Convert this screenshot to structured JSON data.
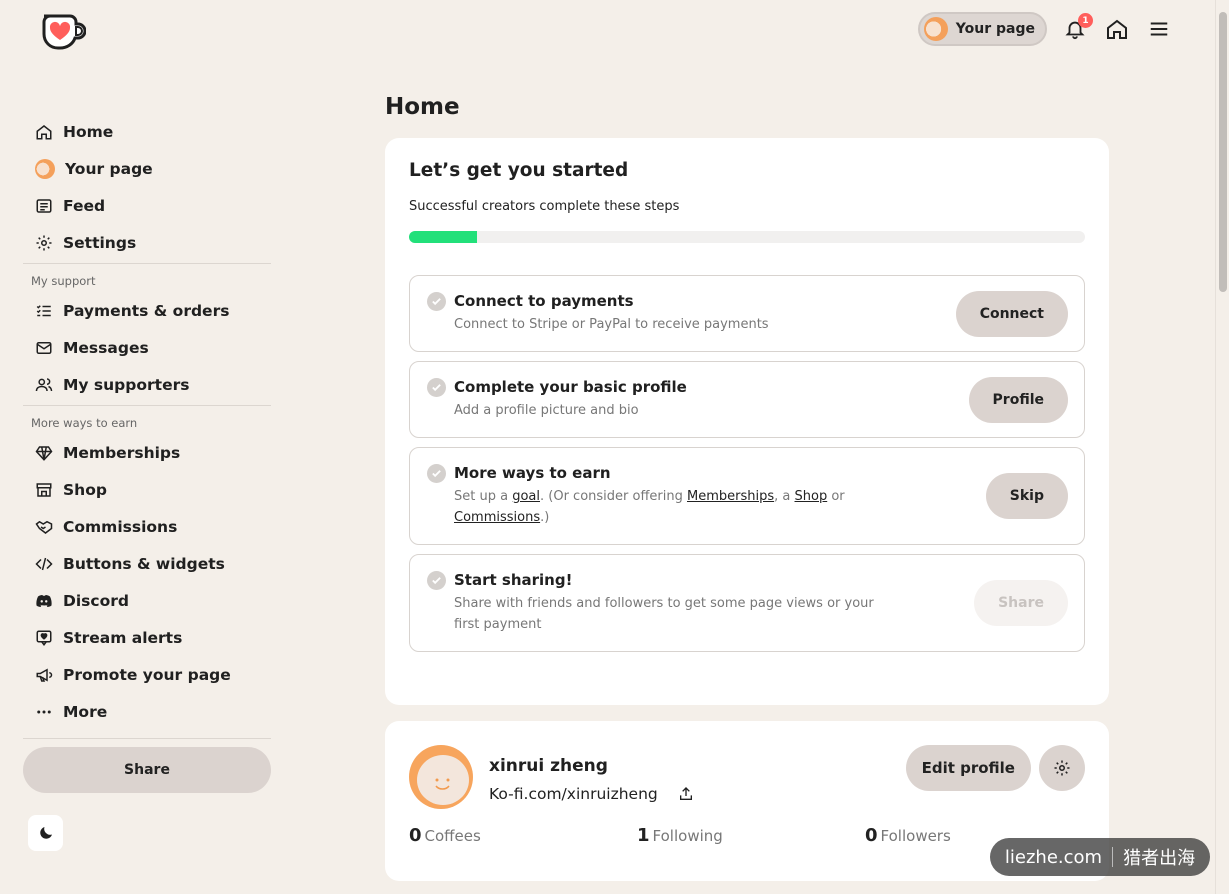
{
  "header": {
    "your_page_label": "Your page",
    "notification_count": "1"
  },
  "sidebar": {
    "items": [
      {
        "label": "Home",
        "icon": "home-icon"
      },
      {
        "label": "Your page",
        "icon": "avatar"
      },
      {
        "label": "Feed",
        "icon": "newspaper-icon"
      },
      {
        "label": "Settings",
        "icon": "gear-icon"
      }
    ],
    "support_label": "My support",
    "support_items": [
      {
        "label": "Payments & orders",
        "icon": "list-icon"
      },
      {
        "label": "Messages",
        "icon": "mail-icon"
      },
      {
        "label": "My supporters",
        "icon": "users-icon"
      }
    ],
    "earn_label": "More ways to earn",
    "earn_items": [
      {
        "label": "Memberships",
        "icon": "diamond-icon"
      },
      {
        "label": "Shop",
        "icon": "store-icon"
      },
      {
        "label": "Commissions",
        "icon": "handshake-icon"
      },
      {
        "label": "Buttons & widgets",
        "icon": "code-icon"
      },
      {
        "label": "Discord",
        "icon": "discord-icon"
      },
      {
        "label": "Stream alerts",
        "icon": "alert-icon"
      },
      {
        "label": "Promote your page",
        "icon": "megaphone-icon"
      },
      {
        "label": "More",
        "icon": "dots-icon"
      }
    ],
    "share_label": "Share"
  },
  "main": {
    "title": "Home",
    "start_card": {
      "title": "Let’s get you started",
      "subtitle": "Successful creators complete these steps",
      "progress": 0.1,
      "steps": [
        {
          "title": "Connect to payments",
          "desc": "Connect to Stripe or PayPal to receive payments",
          "button": "Connect"
        },
        {
          "title": "Complete your basic profile",
          "desc": "Add a profile picture and bio",
          "button": "Profile"
        },
        {
          "title": "More ways to earn",
          "desc_prefix": "Set up a ",
          "desc_goal": "goal",
          "desc_mid": ". (Or consider offering ",
          "desc_memberships": "Memberships",
          "desc_comma": ", a ",
          "desc_shop": "Shop",
          "desc_or": " or ",
          "desc_commissions": "Commissions",
          "desc_end": ".)",
          "button": "Skip"
        },
        {
          "title": "Start sharing!",
          "desc": "Share with friends and followers to get some page views or your first payment",
          "button": "Share"
        }
      ]
    },
    "profile_card": {
      "name": "xinrui zheng",
      "url": "Ko-fi.com/xinruizheng",
      "edit_label": "Edit profile",
      "stats": [
        {
          "value": "0",
          "label": "Coffees"
        },
        {
          "value": "1",
          "label": "Following"
        },
        {
          "value": "0",
          "label": "Followers"
        }
      ]
    }
  },
  "watermark": {
    "left": "liezhe.com",
    "right": "猎者出海"
  }
}
